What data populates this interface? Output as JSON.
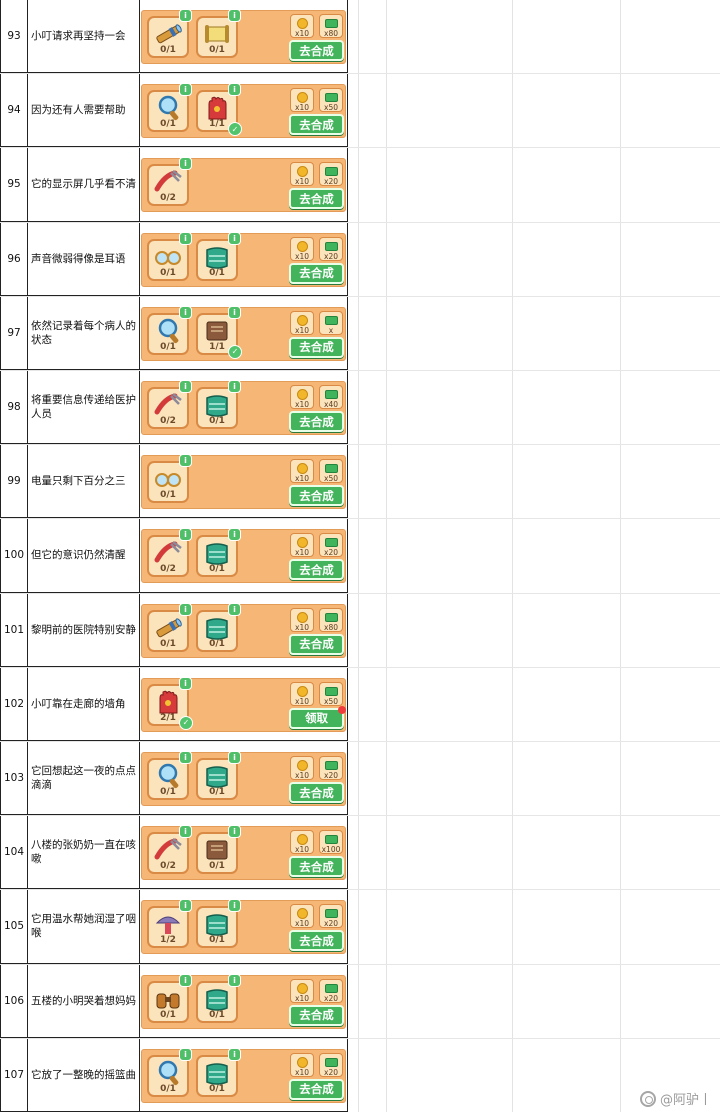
{
  "rows": [
    {
      "num": "93",
      "text": "小叮请求再坚持一会",
      "items": [
        {
          "icon": "telescope-icon",
          "qty": "0/1"
        },
        {
          "icon": "scroll-icon",
          "qty": "0/1"
        }
      ],
      "rewards": [
        "x10",
        "x80"
      ],
      "button": "去合成"
    },
    {
      "num": "94",
      "text": "因为还有人需要帮助",
      "items": [
        {
          "icon": "magnifier-icon",
          "qty": "0/1"
        },
        {
          "icon": "glove-icon",
          "qty": "1/1",
          "done": true
        }
      ],
      "rewards": [
        "x10",
        "x50"
      ],
      "button": "去合成"
    },
    {
      "num": "95",
      "text": "它的显示屏几乎看不清",
      "items": [
        {
          "icon": "clamp-icon",
          "qty": "0/2"
        }
      ],
      "rewards": [
        "x10",
        "x20"
      ],
      "button": "去合成"
    },
    {
      "num": "96",
      "text": "声音微弱得像是耳语",
      "items": [
        {
          "icon": "glasses-icon",
          "qty": "0/1"
        },
        {
          "icon": "blanket-icon",
          "qty": "0/1"
        }
      ],
      "rewards": [
        "x10",
        "x20"
      ],
      "button": "去合成"
    },
    {
      "num": "97",
      "text": "依然记录着每个病人的状态",
      "items": [
        {
          "icon": "magnifier-icon",
          "qty": "0/1"
        },
        {
          "icon": "book-icon",
          "qty": "1/1",
          "done": true
        }
      ],
      "rewards": [
        "x10",
        "x"
      ],
      "button": "去合成"
    },
    {
      "num": "98",
      "text": "将重要信息传递给医护人员",
      "items": [
        {
          "icon": "clamp-icon",
          "qty": "0/2"
        },
        {
          "icon": "blanket-icon",
          "qty": "0/1"
        }
      ],
      "rewards": [
        "x10",
        "x40"
      ],
      "button": "去合成"
    },
    {
      "num": "99",
      "text": "电量只剩下百分之三",
      "items": [
        {
          "icon": "glasses-icon",
          "qty": "0/1"
        }
      ],
      "rewards": [
        "x10",
        "x50"
      ],
      "button": "去合成"
    },
    {
      "num": "100",
      "text": "但它的意识仍然清醒",
      "items": [
        {
          "icon": "clamp-icon",
          "qty": "0/2"
        },
        {
          "icon": "blanket-icon",
          "qty": "0/1"
        }
      ],
      "rewards": [
        "x10",
        "x20"
      ],
      "button": "去合成"
    },
    {
      "num": "101",
      "text": "黎明前的医院特别安静",
      "items": [
        {
          "icon": "telescope-icon",
          "qty": "0/1"
        },
        {
          "icon": "blanket-icon",
          "qty": "0/1"
        }
      ],
      "rewards": [
        "x10",
        "x80"
      ],
      "button": "去合成"
    },
    {
      "num": "102",
      "text": "小叮靠在走廊的墙角",
      "items": [
        {
          "icon": "glove-icon",
          "qty": "2/1",
          "done": true
        }
      ],
      "rewards": [
        "x10",
        "x50"
      ],
      "button": "领取",
      "red_dot": true
    },
    {
      "num": "103",
      "text": "它回想起这一夜的点点滴滴",
      "items": [
        {
          "icon": "magnifier-icon",
          "qty": "0/1"
        },
        {
          "icon": "blanket-icon",
          "qty": "0/1"
        }
      ],
      "rewards": [
        "x10",
        "x20"
      ],
      "button": "去合成"
    },
    {
      "num": "104",
      "text": "八楼的张奶奶一直在咳嗽",
      "items": [
        {
          "icon": "clamp-icon",
          "qty": "0/2"
        },
        {
          "icon": "book-icon",
          "qty": "0/1"
        }
      ],
      "rewards": [
        "x10",
        "x100"
      ],
      "button": "去合成"
    },
    {
      "num": "105",
      "text": "它用温水帮她润湿了咽喉",
      "items": [
        {
          "icon": "mushroom-icon",
          "qty": "1/2"
        },
        {
          "icon": "blanket-icon",
          "qty": "0/1"
        }
      ],
      "rewards": [
        "x10",
        "x20"
      ],
      "button": "去合成"
    },
    {
      "num": "106",
      "text": "五楼的小明哭着想妈妈",
      "items": [
        {
          "icon": "binoculars-icon",
          "qty": "0/1"
        },
        {
          "icon": "blanket-icon",
          "qty": "0/1"
        }
      ],
      "rewards": [
        "x10",
        "x20"
      ],
      "button": "去合成"
    },
    {
      "num": "107",
      "text": "它放了一整晚的摇篮曲",
      "items": [
        {
          "icon": "magnifier-icon",
          "qty": "0/1"
        },
        {
          "icon": "blanket-icon",
          "qty": "0/1"
        }
      ],
      "rewards": [
        "x10",
        "x20"
      ],
      "button": "去合成"
    }
  ],
  "watermark": "@阿驴丨",
  "colors": {
    "card": "#f6b676",
    "slot": "#fbe3bb",
    "button": "#43b35c",
    "info": "#4fbf6a"
  }
}
